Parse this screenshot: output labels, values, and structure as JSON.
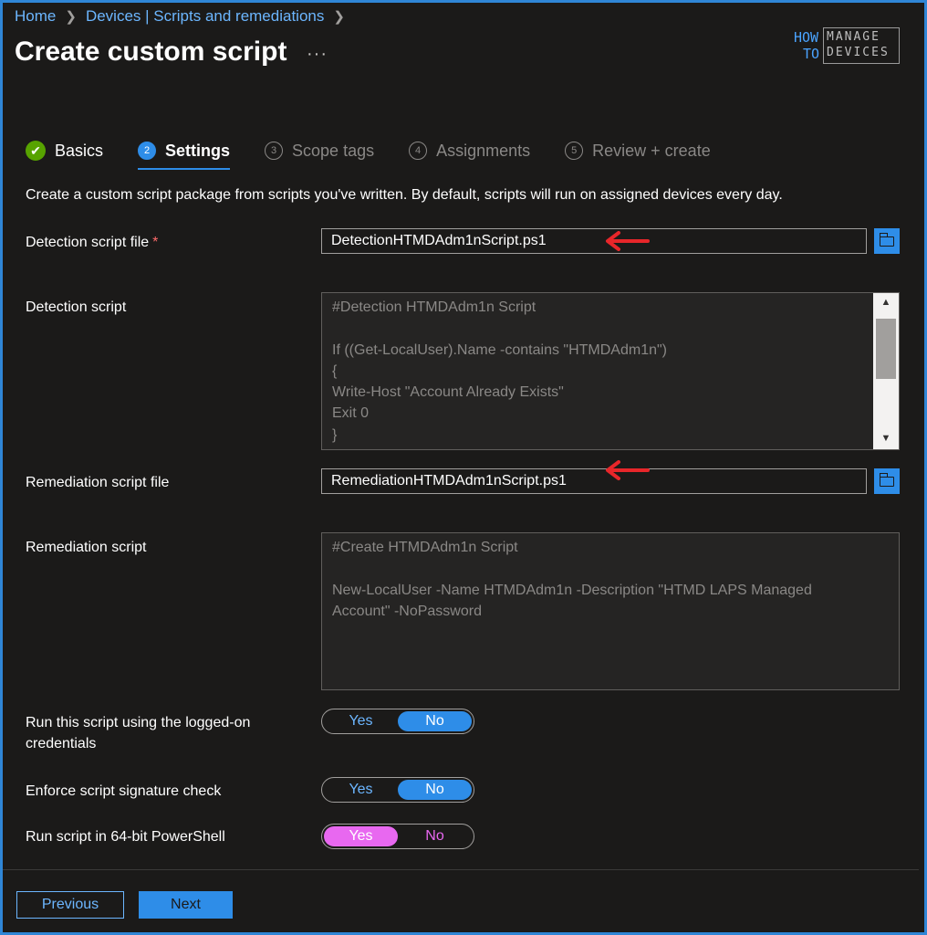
{
  "breadcrumb": {
    "home": "Home",
    "devices": "Devices | Scripts and remediations"
  },
  "page": {
    "title": "Create custom script"
  },
  "logo": {
    "how": "HOW",
    "to": "TO",
    "manage": "MANAGE",
    "devices": "DEVICES"
  },
  "steps": [
    {
      "num": "1",
      "label": "Basics",
      "state": "done"
    },
    {
      "num": "2",
      "label": "Settings",
      "state": "active"
    },
    {
      "num": "3",
      "label": "Scope tags",
      "state": "inactive"
    },
    {
      "num": "4",
      "label": "Assignments",
      "state": "inactive"
    },
    {
      "num": "5",
      "label": "Review + create",
      "state": "inactive"
    }
  ],
  "description": "Create a custom script package from scripts you've written. By default, scripts will run on assigned devices every day.",
  "detection": {
    "file_label": "Detection script file",
    "required_mark": "*",
    "file_value": "DetectionHTMDAdm1nScript.ps1",
    "script_label": "Detection script",
    "script_lines": [
      "#Detection HTMDAdm1n Script",
      "",
      "If ((Get-LocalUser).Name -contains \"HTMDAdm1n\")",
      "{",
      "Write-Host \"Account Already Exists\"",
      "Exit 0",
      "}"
    ]
  },
  "remediation": {
    "file_label": "Remediation script file",
    "file_value": "RemediationHTMDAdm1nScript.ps1",
    "script_label": "Remediation script",
    "script_lines": [
      "#Create HTMDAdm1n Script",
      "",
      "New-LocalUser -Name HTMDAdm1n -Description \"HTMD LAPS Managed",
      "Account\" -NoPassword"
    ]
  },
  "toggles": {
    "logged_on": {
      "label_line1": "Run this script using the logged-on",
      "label_line2": "credentials",
      "yes": "Yes",
      "no": "No",
      "selected": "No"
    },
    "signature": {
      "label": "Enforce script signature check",
      "yes": "Yes",
      "no": "No",
      "selected": "No"
    },
    "powershell64": {
      "label": "Run script in 64-bit PowerShell",
      "yes": "Yes",
      "no": "No",
      "selected": "Yes"
    }
  },
  "footer": {
    "previous": "Previous",
    "next": "Next"
  },
  "colors": {
    "accent": "#2e8de8",
    "link": "#6cb6ff",
    "annotation_arrow": "#e8262a",
    "highlight": "#e868f0",
    "success": "#57a300"
  }
}
